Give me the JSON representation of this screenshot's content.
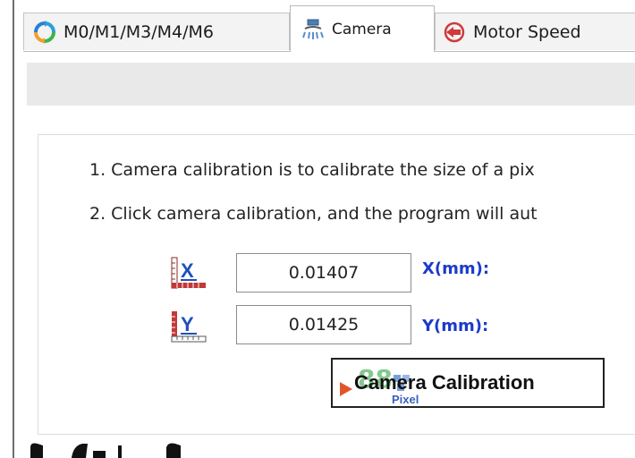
{
  "tabs": [
    {
      "label": "M0/M1/M3/M4/M6",
      "icon": "refresh-icon",
      "active": false
    },
    {
      "label": "Camera",
      "icon": "camera-icon",
      "active": true
    },
    {
      "label": "Motor Speed",
      "icon": "motor-speed-icon",
      "active": false
    }
  ],
  "instructions": [
    "1. Camera calibration is to calibrate the size of a pix",
    "2. Click camera calibration, and the program will aut"
  ],
  "calibration": {
    "x": {
      "value": "0.01407",
      "unit_label": "X(mm):",
      "icon": "x-ruler-icon"
    },
    "y": {
      "value": "0.01425",
      "unit_label": "Y(mm):",
      "icon": "y-ruler-icon"
    }
  },
  "button": {
    "label": "Camera Calibration",
    "icon": "pixel-calibration-icon",
    "icon_text": "Pixel"
  },
  "colors": {
    "unit_label": "#1c3acb",
    "toolbar_band": "#e9e9e9",
    "tab_active": "#ffffff",
    "tab_inactive": "#f3f3f3"
  }
}
